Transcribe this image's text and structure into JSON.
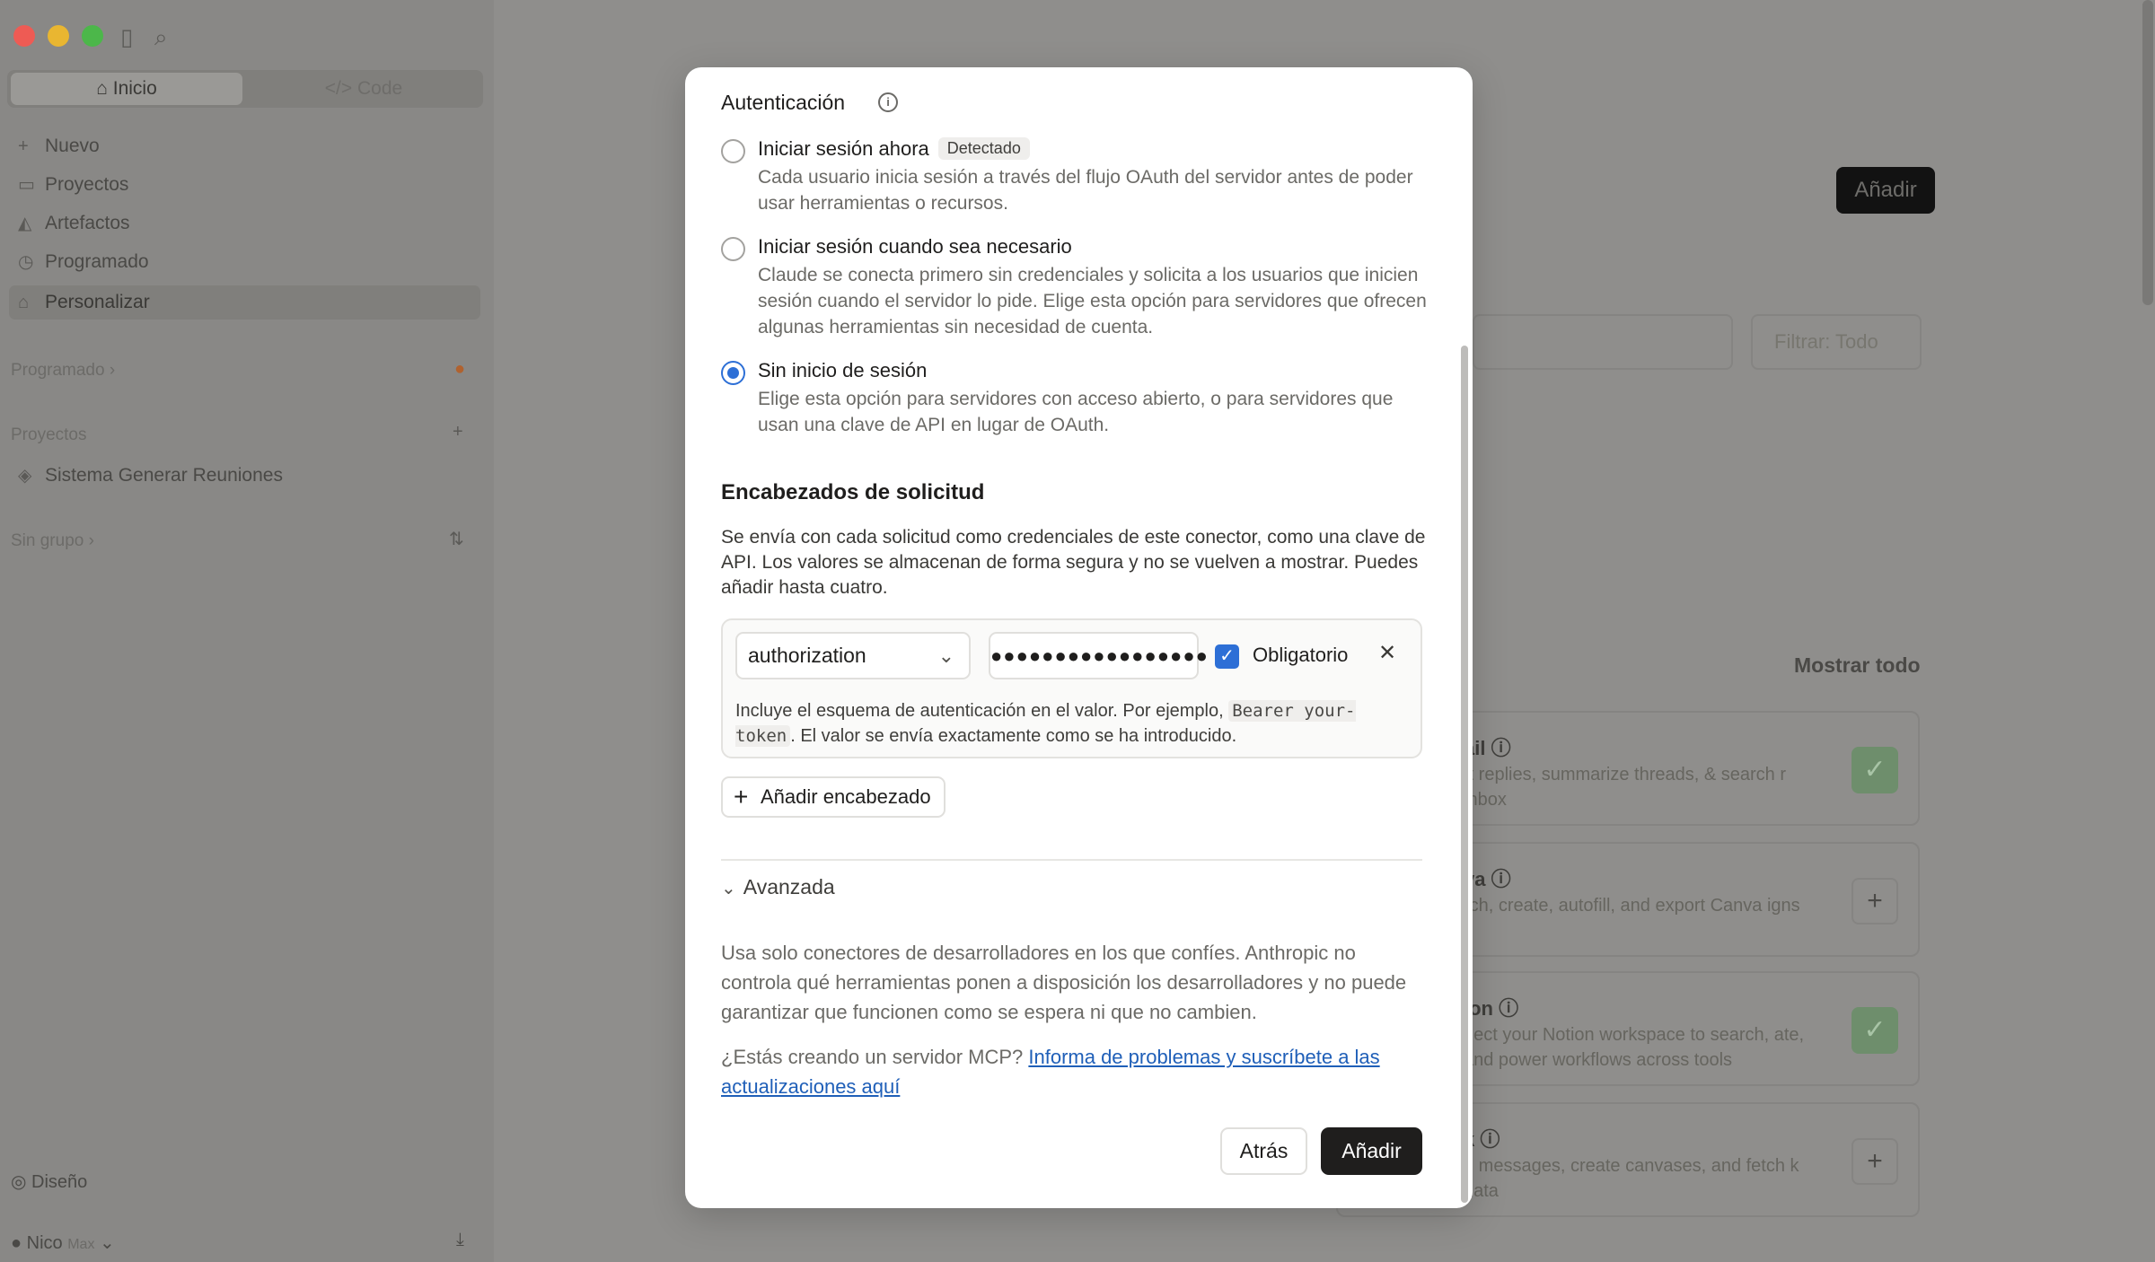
{
  "background": {
    "tabs": [
      "Inicio",
      "Code"
    ],
    "nav": [
      {
        "label": "Nuevo",
        "icon": "plus-icon"
      },
      {
        "label": "Proyectos",
        "icon": "folder-icon"
      },
      {
        "label": "Artefactos",
        "icon": "artifact-icon"
      },
      {
        "label": "Programado",
        "icon": "clock-icon"
      },
      {
        "label": "Personalizar",
        "icon": "customize-icon"
      }
    ],
    "sections": {
      "programado": "Programado",
      "proyectos": "Proyectos",
      "project_item": "Sistema Generar Reuniones",
      "sin_grupo": "Sin grupo"
    },
    "bottom": {
      "design": "Diseño",
      "user": "Nico",
      "plan": "Max"
    },
    "main": {
      "add_button": "Añadir",
      "filter": "Filtrar: Todo",
      "show_all": "Mostrar todo",
      "cards": [
        {
          "title": "ail",
          "desc": "ft replies, summarize threads, & search r inbox",
          "state": "checked"
        },
        {
          "title": "va",
          "desc": "rch, create, autofill, and export Canva igns",
          "state": "add"
        },
        {
          "title": "ion",
          "desc": "nect your Notion workspace to search, ate, and power workflows across tools",
          "state": "checked"
        },
        {
          "title": "k",
          "desc": "d messages, create canvases, and fetch k data",
          "state": "add"
        }
      ]
    }
  },
  "modal": {
    "auth_title": "Autenticación",
    "options": [
      {
        "label": "Iniciar sesión ahora",
        "badge": "Detectado",
        "desc": "Cada usuario inicia sesión a través del flujo OAuth del servidor antes de poder usar herramientas o recursos.",
        "selected": false
      },
      {
        "label": "Iniciar sesión cuando sea necesario",
        "desc": "Claude se conecta primero sin credenciales y solicita a los usuarios que inicien sesión cuando el servidor lo pide. Elige esta opción para servidores que ofrecen algunas herramientas sin necesidad de cuenta.",
        "selected": false
      },
      {
        "label": "Sin inicio de sesión",
        "desc": "Elige esta opción para servidores con acceso abierto, o para servidores que usan una clave de API en lugar de OAuth.",
        "selected": true
      }
    ],
    "headers_title": "Encabezados de solicitud",
    "headers_desc": "Se envía con cada solicitud como credenciales de este conector, como una clave de API. Los valores se almacenan de forma segura y no se vuelven a mostrar. Puedes añadir hasta cuatro.",
    "header_row": {
      "name": "authorization",
      "value": "●●●●●●●●●●●●●●●●●",
      "required_label": "Obligatorio",
      "required_checked": true,
      "hint_before": "Incluye el esquema de autenticación en el valor. Por ejemplo, ",
      "hint_code": "Bearer your-token",
      "hint_after": ". El valor se envía exactamente como se ha introducido."
    },
    "add_header": "Añadir encabezado",
    "advanced": "Avanzada",
    "warning": "Usa solo conectores de desarrolladores en los que confíes. Anthropic no controla qué herramientas ponen a disposición los desarrolladores y no puede garantizar que funcionen como se espera ni que no cambien.",
    "mcp_prefix": "¿Estás creando un servidor MCP? ",
    "mcp_link": "Informa de problemas y suscríbete a las actualizaciones aquí",
    "back": "Atrás",
    "add": "Añadir"
  }
}
